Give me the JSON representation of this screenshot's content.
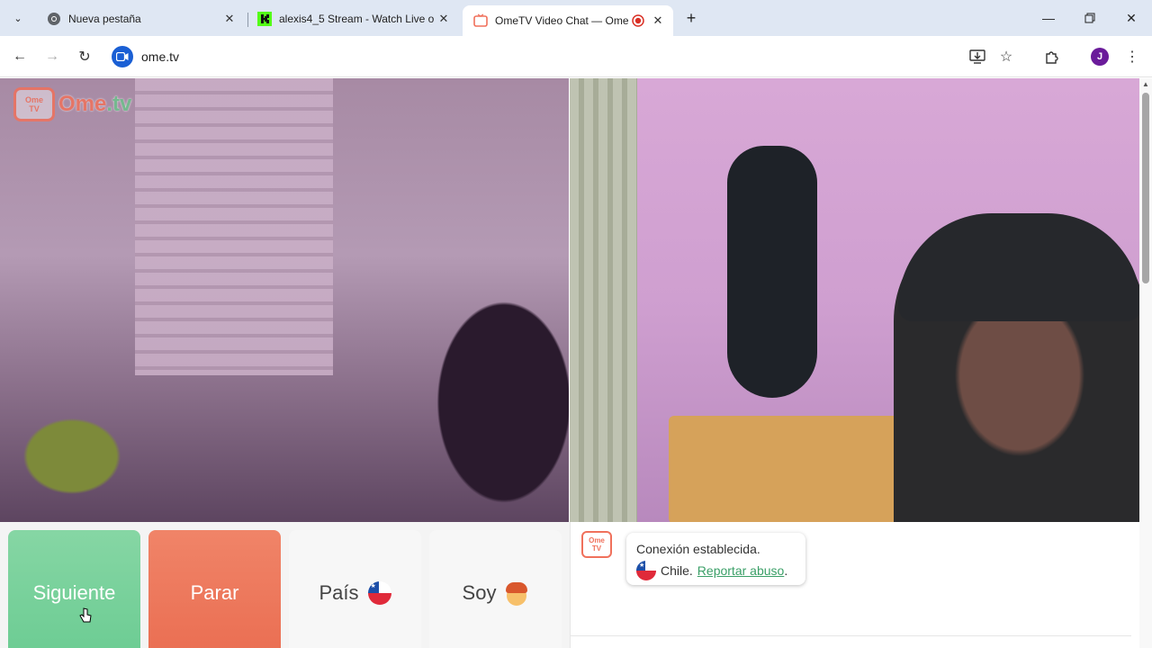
{
  "browser": {
    "tabs": [
      {
        "title": "Nueva pestaña",
        "favicon": "chrome-icon"
      },
      {
        "title": "alexis4_5 Stream - Watch Live o",
        "favicon": "kick-icon"
      },
      {
        "title": "OmeTV Video Chat — Ome",
        "favicon": "ometv-icon",
        "active": true,
        "recording": true
      }
    ],
    "url": "ome.tv",
    "profile_initial": "J"
  },
  "page": {
    "logo": {
      "tv_top": "Ome",
      "tv_bottom": "TV",
      "brand": "Ome",
      "brand_suffix": ".tv"
    },
    "controls": {
      "next_label": "Siguiente",
      "stop_label": "Parar",
      "country_label": "País",
      "gender_label": "Soy"
    },
    "chat": {
      "logo_top": "Ome",
      "logo_bottom": "TV",
      "message_line1": "Conexión establecida.",
      "country": "Chile.",
      "report_link": "Reportar abuso",
      "period": "."
    }
  },
  "colors": {
    "next": "#6ccc93",
    "stop": "#ea6e52",
    "brand": "#f0715c",
    "link": "#3a9f67"
  }
}
